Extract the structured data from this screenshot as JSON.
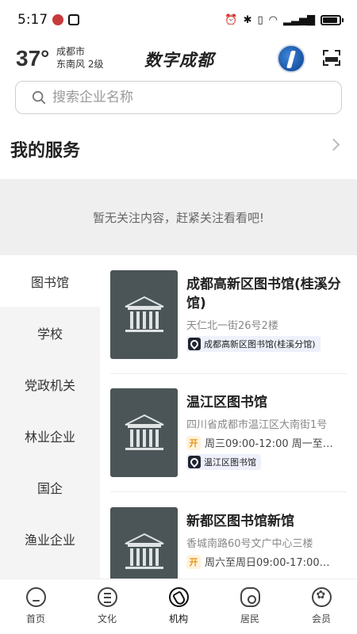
{
  "statusbar": {
    "time": "5:17",
    "icons_left": [
      "app-icon",
      "nfc-icon"
    ],
    "icons_right": [
      "alarm-icon",
      "bluetooth-icon",
      "vibrate-icon",
      "wifi-icon",
      "signal-icon",
      "battery-icon"
    ]
  },
  "header": {
    "temperature": "37°",
    "city": "成都市",
    "wind": "东南风  2级",
    "brand": "数字成都",
    "accent": "#1a5fbf"
  },
  "search": {
    "placeholder": "搜索企业名称"
  },
  "services": {
    "title": "我的服务",
    "empty_text": "暂无关注内容，赶紧关注看看吧!"
  },
  "categories": [
    {
      "label": "图书馆",
      "active": true
    },
    {
      "label": "学校",
      "active": false
    },
    {
      "label": "党政机关",
      "active": false
    },
    {
      "label": "林业企业",
      "active": false
    },
    {
      "label": "国企",
      "active": false
    },
    {
      "label": "渔业企业",
      "active": false
    }
  ],
  "places": [
    {
      "name": "成都高新区图书馆(桂溪分馆)",
      "address": "天仁北一街26号2楼",
      "hours_badge": "",
      "hours": "",
      "tag": "成都高新区图书馆(桂溪分馆)"
    },
    {
      "name": "温江区图书馆",
      "address": "四川省成都市温江区大南街1号",
      "hours_badge": "开",
      "hours": "周三09:00-12:00 周一至…",
      "tag": "温江区图书馆"
    },
    {
      "name": "新都区图书馆新馆",
      "address": "香城南路60号文广中心三楼",
      "hours_badge": "开",
      "hours": "周六至周日09:00-17:00…",
      "tag": ""
    }
  ],
  "bottom_nav": [
    {
      "label": "首页",
      "icon": "home-icon",
      "active": false
    },
    {
      "label": "文化",
      "icon": "culture-icon",
      "active": false
    },
    {
      "label": "机构",
      "icon": "organization-icon",
      "active": true
    },
    {
      "label": "居民",
      "icon": "resident-icon",
      "active": false
    },
    {
      "label": "会员",
      "icon": "member-icon",
      "active": false
    }
  ]
}
